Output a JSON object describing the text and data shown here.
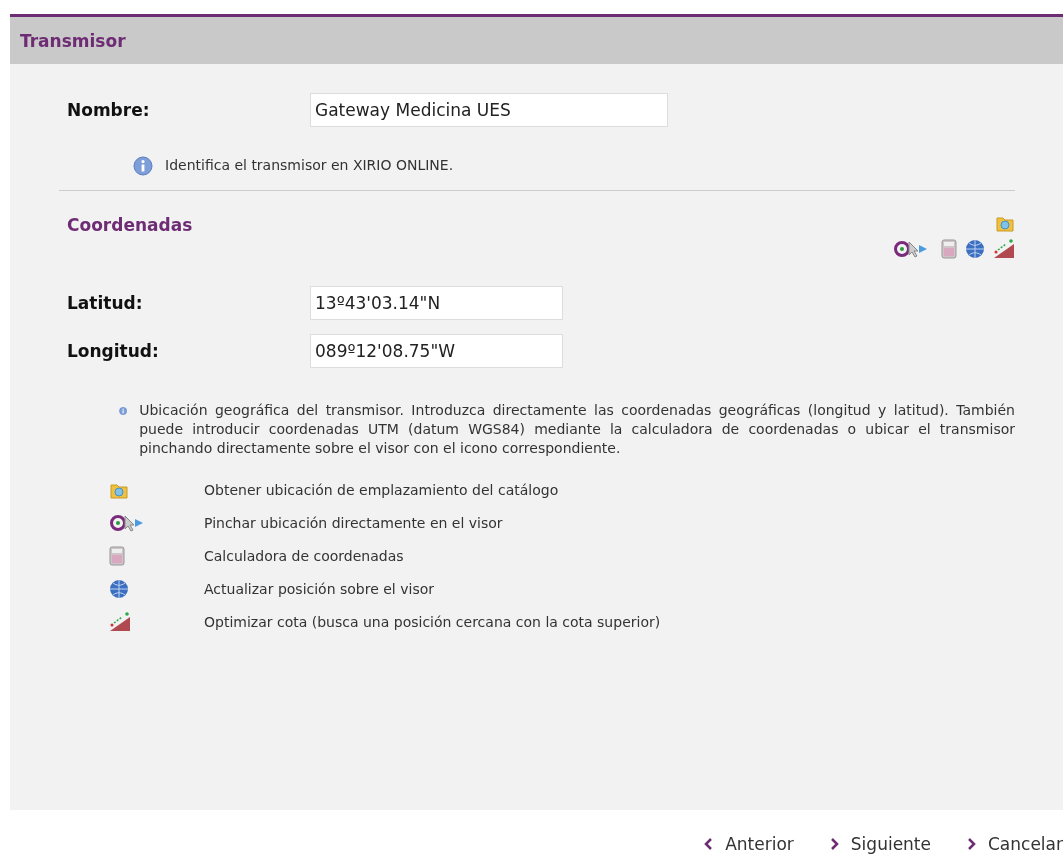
{
  "panel": {
    "title": "Transmisor"
  },
  "name_field": {
    "label": "Nombre:",
    "value": "Gateway Medicina UES"
  },
  "name_info": "Identifica el transmisor en XIRIO ONLINE.",
  "coordinates": {
    "title": "Coordenadas",
    "tools": [
      {
        "kind": "catalog"
      },
      {
        "kind": "pick"
      },
      {
        "kind": "calculator"
      },
      {
        "kind": "globe"
      },
      {
        "kind": "slope"
      }
    ],
    "fields": [
      {
        "label": "Latitud:",
        "value": "13º43'03.14\"N"
      },
      {
        "label": "Longitud:",
        "value": "089º12'08.75\"W"
      }
    ],
    "info": "Ubicación geográfica del transmisor. Introduzca directamente las coordenadas geográficas (longitud y latitud). También puede introducir coordenadas UTM (datum WGS84) mediante la calculadora de coordenadas o ubicar el transmisor pinchando directamente sobre el visor con el icono correspondiente.",
    "legend": [
      {
        "kind": "catalog",
        "text": "Obtener ubicación de emplazamiento del catálogo"
      },
      {
        "kind": "pick",
        "text": "Pinchar ubicación directamente en el visor"
      },
      {
        "kind": "calculator",
        "text": "Calculadora de coordenadas"
      },
      {
        "kind": "globe",
        "text": "Actualizar posición sobre el visor"
      },
      {
        "kind": "slope",
        "text": "Optimizar cota (busca una posición cercana con la cota superior)"
      }
    ]
  },
  "nav": [
    {
      "kind": "back",
      "label": "Anterior"
    },
    {
      "kind": "next",
      "label": "Siguiente"
    },
    {
      "kind": "next",
      "label": "Cancelar"
    }
  ]
}
